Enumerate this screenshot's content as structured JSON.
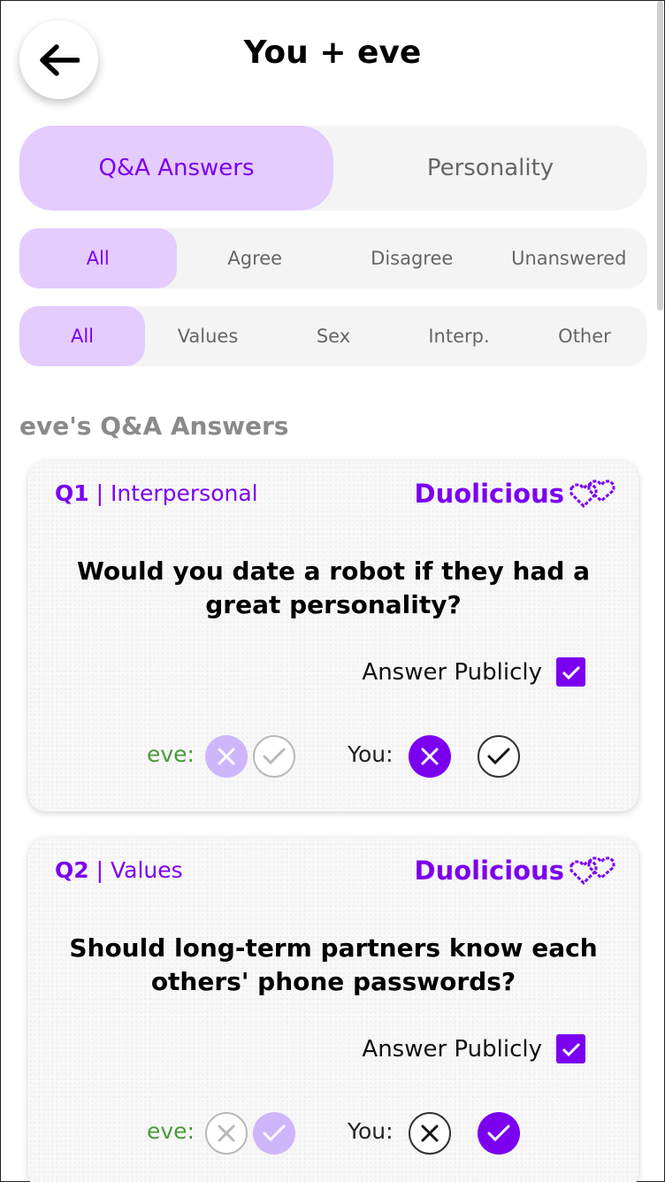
{
  "header": {
    "title": "You + eve",
    "back_icon": "arrow-left-icon"
  },
  "main_tabs": [
    {
      "label": "Q&A Answers",
      "active": true
    },
    {
      "label": "Personality",
      "active": false
    }
  ],
  "answer_filters": [
    {
      "label": "All",
      "active": true
    },
    {
      "label": "Agree",
      "active": false
    },
    {
      "label": "Disagree",
      "active": false
    },
    {
      "label": "Unanswered",
      "active": false
    }
  ],
  "category_filters": [
    {
      "label": "All",
      "active": true
    },
    {
      "label": "Values",
      "active": false
    },
    {
      "label": "Sex",
      "active": false
    },
    {
      "label": "Interp.",
      "active": false
    },
    {
      "label": "Other",
      "active": false
    }
  ],
  "section_title": "eve's Q&A Answers",
  "colors": {
    "accent": "#7b00f0",
    "accent_light": "#e4ccff",
    "eve_label": "#4a9a3a"
  },
  "cards": [
    {
      "qnum": "Q1",
      "category": " | Interpersonal",
      "brand": "Duolicious",
      "question": "Would you date a robot if they had a great personality?",
      "public_label": "Answer Publicly",
      "public_checked": true,
      "eve_label": "eve:",
      "you_label": "You:",
      "eve_answer": "no",
      "you_answer": "no"
    },
    {
      "qnum": "Q2",
      "category": " | Values",
      "brand": "Duolicious",
      "question": "Should long-term partners know each others' phone passwords?",
      "public_label": "Answer Publicly",
      "public_checked": true,
      "eve_label": "eve:",
      "you_label": "You:",
      "eve_answer": "yes",
      "you_answer": "yes"
    }
  ]
}
